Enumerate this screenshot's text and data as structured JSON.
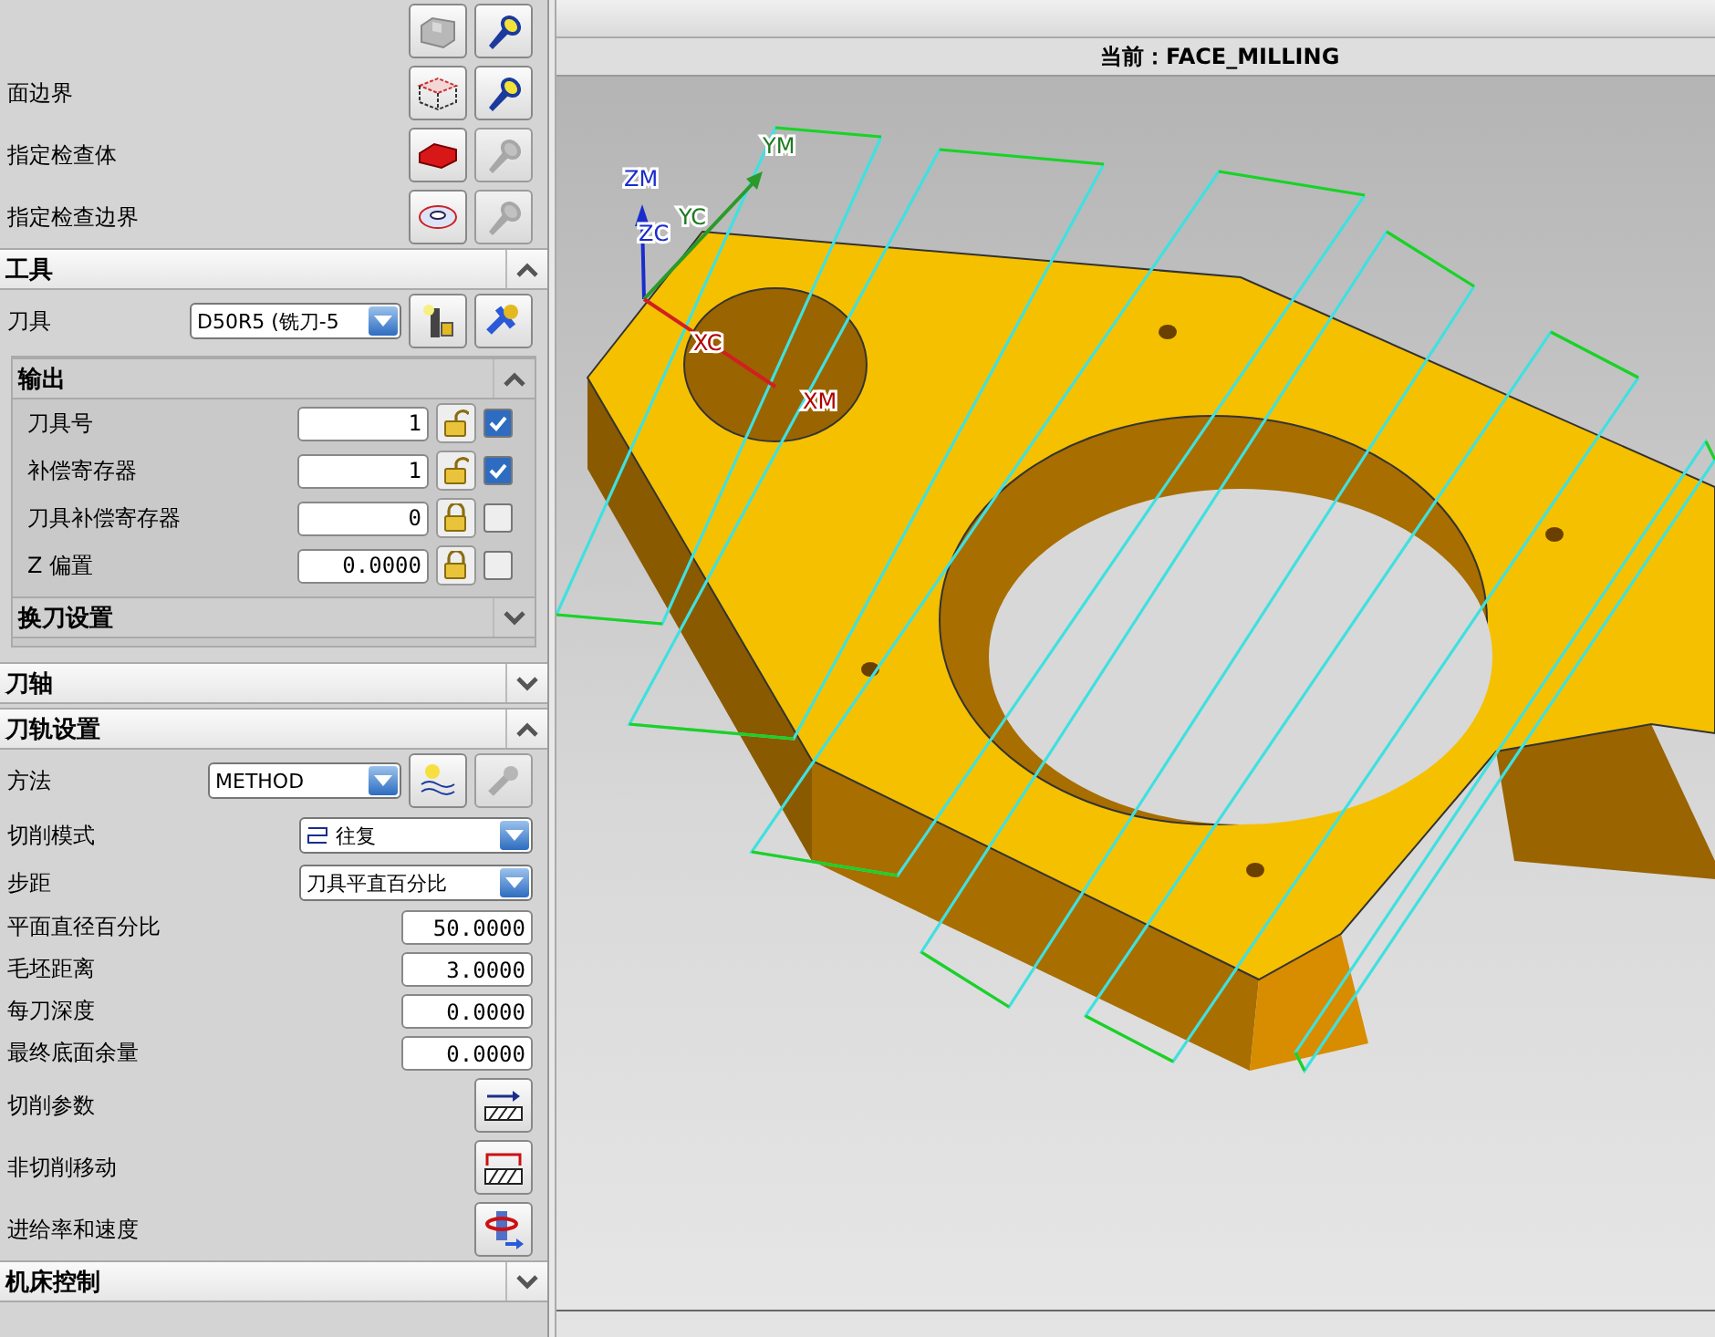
{
  "geometry_rows": [
    {
      "label": "",
      "display_enabled": true
    },
    {
      "label": "面边界",
      "display_enabled": true
    },
    {
      "label": "指定检查体",
      "display_enabled": false
    },
    {
      "label": "指定检查边界",
      "display_enabled": false
    }
  ],
  "tool_section": {
    "title": "工具",
    "expanded": true
  },
  "tool": {
    "label": "刀具",
    "value": "D50R5 (铣刀-5"
  },
  "output": {
    "title": "输出",
    "expanded": true,
    "rows": [
      {
        "label": "刀具号",
        "value": "1",
        "locked": false,
        "checked": true
      },
      {
        "label": "补偿寄存器",
        "value": "1",
        "locked": false,
        "checked": true
      },
      {
        "label": "刀具补偿寄存器",
        "value": "0",
        "locked": true,
        "checked": false
      },
      {
        "label": "Z 偏置",
        "value": "0.0000",
        "locked": true,
        "checked": false
      }
    ]
  },
  "tool_change": {
    "title": "换刀设置",
    "expanded": false
  },
  "tool_axis": {
    "title": "刀轴",
    "expanded": false
  },
  "path_settings": {
    "title": "刀轨设置",
    "expanded": true
  },
  "method": {
    "label": "方法",
    "value": "METHOD"
  },
  "cut_pattern": {
    "label": "切削模式",
    "value": "往复"
  },
  "stepover": {
    "label": "步距",
    "value": "刀具平直百分比"
  },
  "numeric_fields": [
    {
      "label": "平面直径百分比",
      "value": "50.0000"
    },
    {
      "label": "毛坯距离",
      "value": "3.0000"
    },
    {
      "label": "每刀深度",
      "value": "0.0000"
    },
    {
      "label": "最终底面余量",
      "value": "0.0000"
    }
  ],
  "actions": [
    {
      "label": "切削参数"
    },
    {
      "label": "非切削移动"
    },
    {
      "label": "进给率和速度"
    }
  ],
  "machine_control": {
    "title": "机床控制",
    "expanded": false
  },
  "viewport": {
    "status": "当前：FACE_MILLING",
    "axis_labels": [
      "ZM",
      "YM",
      "ZC",
      "YC",
      "XC",
      "XM"
    ]
  }
}
